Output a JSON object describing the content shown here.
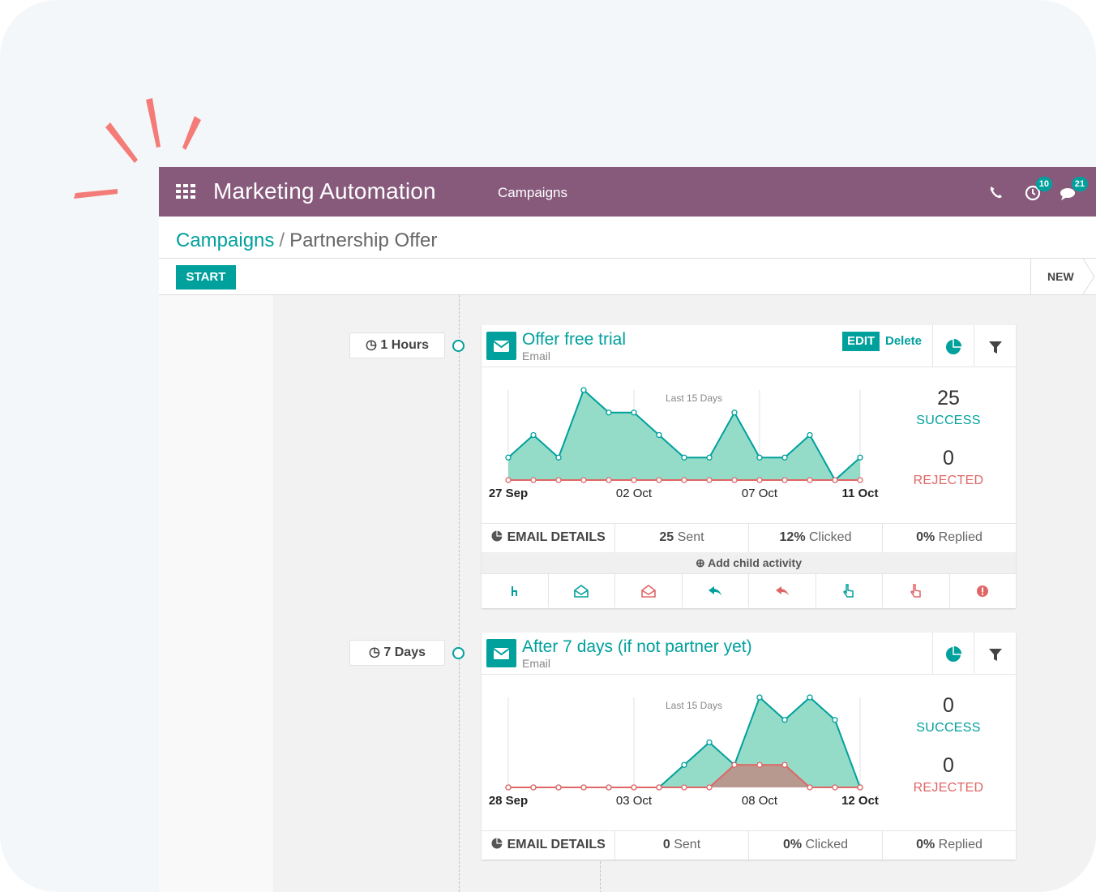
{
  "topbar": {
    "app_title": "Marketing Automation",
    "menu_campaigns": "Campaigns",
    "activity_badge": "10",
    "messages_badge": "21",
    "icons": [
      "apps-grid-icon",
      "phone-icon",
      "activity-clock-icon",
      "chat-bubbles-icon"
    ]
  },
  "breadcrumb": {
    "parent": "Campaigns",
    "separator": "/",
    "current": "Partnership Offer"
  },
  "control": {
    "start_label": "START",
    "status_label": "NEW"
  },
  "colors": {
    "brand": "#875a7b",
    "accent": "#00a09d",
    "success_fill": "#95dcc8",
    "rejected": "#e06666"
  },
  "activities": [
    {
      "delay": "1 Hours",
      "title": "Offer free trial",
      "type": "Email",
      "edit_label": "EDIT",
      "delete_label": "Delete",
      "success_count": "25",
      "success_label": "SUCCESS",
      "rejected_count": "0",
      "rejected_label": "REJECTED",
      "details_label": "EMAIL DETAILS",
      "sent_value": "25",
      "sent_label": "Sent",
      "clicked_value": "12%",
      "clicked_label": "Clicked",
      "replied_value": "0%",
      "replied_label": "Replied",
      "add_child_label": "Add child activity",
      "trigger_icons": [
        "child-trigger-icon",
        "opened-icon",
        "not-opened-icon",
        "replied-icon",
        "not-replied-icon",
        "clicked-icon",
        "not-clicked-icon",
        "bounced-icon"
      ]
    },
    {
      "delay": "7 Days",
      "title": "After 7 days (if not partner yet)",
      "type": "Email",
      "success_count": "0",
      "success_label": "SUCCESS",
      "rejected_count": "0",
      "rejected_label": "REJECTED",
      "details_label": "EMAIL DETAILS",
      "sent_value": "0",
      "sent_label": "Sent",
      "clicked_value": "0%",
      "clicked_label": "Clicked",
      "replied_value": "0%",
      "replied_label": "Replied"
    }
  ],
  "chart_data": [
    {
      "type": "area",
      "title": "Last 15 Days",
      "x": [
        "27 Sep",
        "28 Sep",
        "29 Sep",
        "30 Sep",
        "01 Oct",
        "02 Oct",
        "03 Oct",
        "04 Oct",
        "05 Oct",
        "06 Oct",
        "07 Oct",
        "08 Oct",
        "09 Oct",
        "10 Oct",
        "11 Oct"
      ],
      "tick_labels": [
        "27 Sep",
        "02 Oct",
        "07 Oct",
        "11 Oct"
      ],
      "tick_indices": [
        0,
        5,
        10,
        14
      ],
      "bold_ticks": [
        0,
        14
      ],
      "ylim": [
        0,
        4
      ],
      "grid": "vertical-lines",
      "series": [
        {
          "role": "success",
          "color": "#00a09d",
          "values": [
            1,
            2,
            1,
            4,
            3,
            3,
            2,
            1,
            1,
            3,
            1,
            1,
            2,
            0,
            1
          ]
        },
        {
          "role": "rejected",
          "color": "#e06666",
          "values": [
            0,
            0,
            0,
            0,
            0,
            0,
            0,
            0,
            0,
            0,
            0,
            0,
            0,
            0,
            0
          ]
        }
      ]
    },
    {
      "type": "area",
      "title": "Last 15 Days",
      "x": [
        "28 Sep",
        "29 Sep",
        "30 Sep",
        "01 Oct",
        "02 Oct",
        "03 Oct",
        "04 Oct",
        "05 Oct",
        "06 Oct",
        "07 Oct",
        "08 Oct",
        "09 Oct",
        "10 Oct",
        "11 Oct",
        "12 Oct"
      ],
      "tick_labels": [
        "28 Sep",
        "03 Oct",
        "08 Oct",
        "12 Oct"
      ],
      "tick_indices": [
        0,
        5,
        10,
        14
      ],
      "bold_ticks": [
        0,
        14
      ],
      "ylim": [
        0,
        4
      ],
      "grid": "vertical-lines",
      "series": [
        {
          "role": "success",
          "color": "#00a09d",
          "values": [
            0,
            0,
            0,
            0,
            0,
            0,
            0,
            1,
            2,
            1,
            4,
            3,
            4,
            3,
            0
          ]
        },
        {
          "role": "rejected",
          "color": "#e06666",
          "values": [
            0,
            0,
            0,
            0,
            0,
            0,
            0,
            0,
            0,
            1,
            1,
            1,
            0,
            0,
            0
          ]
        }
      ]
    }
  ]
}
